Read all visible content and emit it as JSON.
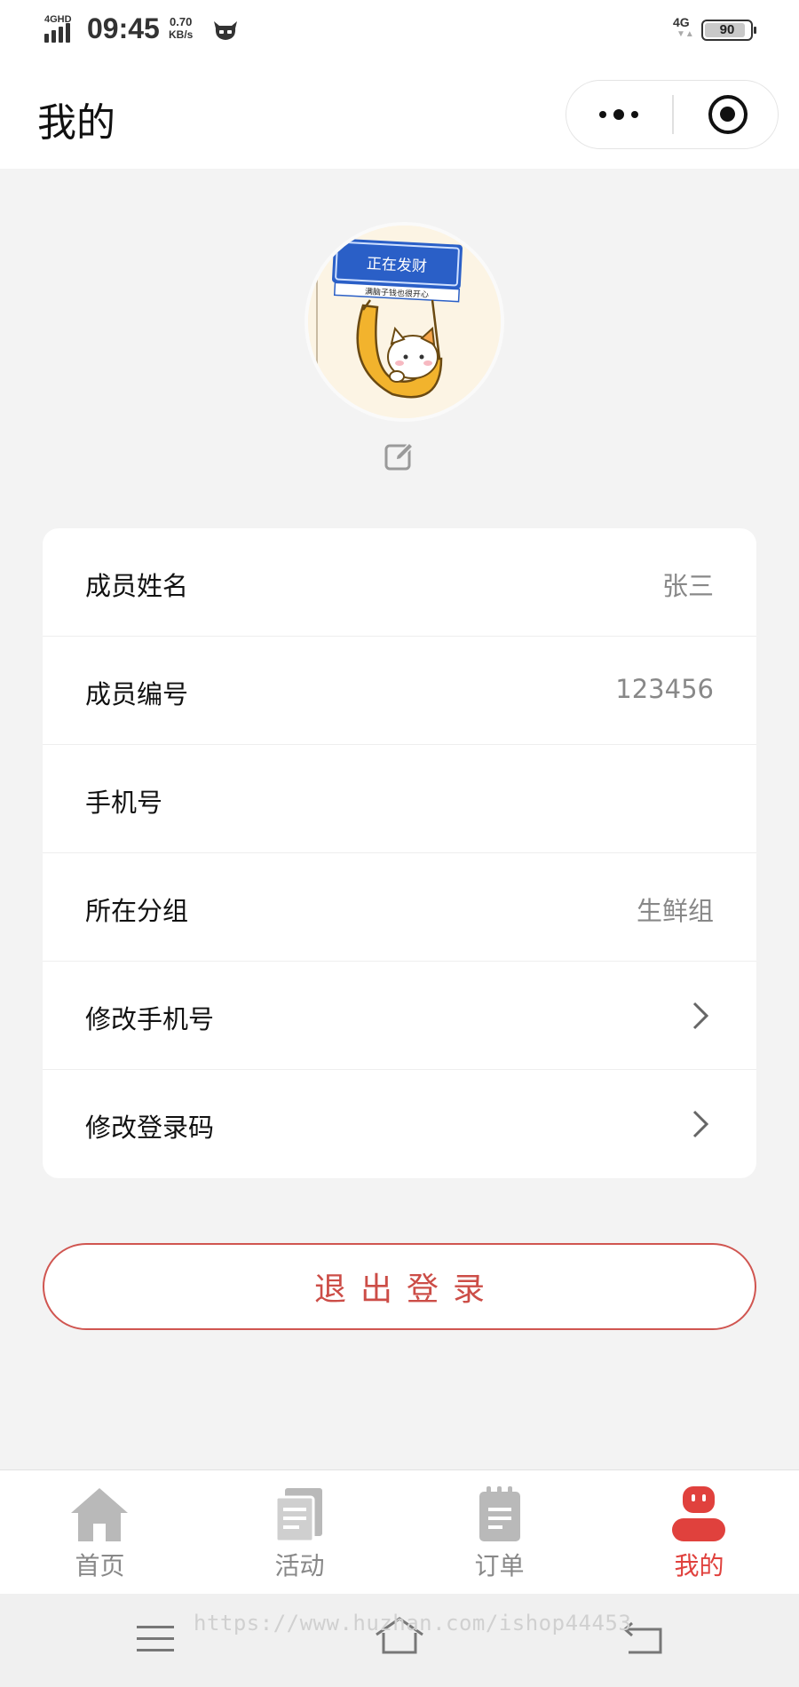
{
  "status_bar": {
    "network": "4GHD",
    "time": "09:45",
    "speed_value": "0.70",
    "speed_unit": "KB/s",
    "network_right": "4G",
    "battery": "90"
  },
  "nav": {
    "title": "我的",
    "more_icon": "more-dots-icon",
    "close_icon": "target-icon"
  },
  "profile": {
    "avatar_sign_text": "正在发财",
    "avatar_sign_subtext": "满脑子钱也很开心",
    "edit_icon": "edit-icon"
  },
  "info_rows": [
    {
      "label": "成员姓名",
      "value": "张三"
    },
    {
      "label": "成员编号",
      "value": "123456"
    },
    {
      "label": "手机号",
      "value": ""
    },
    {
      "label": "所在分组",
      "value": "生鲜组"
    },
    {
      "label": "修改手机号",
      "icon": "chevron-right-icon"
    },
    {
      "label": "修改登录码",
      "icon": "chevron-right-icon"
    }
  ],
  "logout_label": "退出登录",
  "tabs": [
    {
      "label": "首页",
      "icon": "home-icon"
    },
    {
      "label": "活动",
      "icon": "document-icon"
    },
    {
      "label": "订单",
      "icon": "clipboard-icon"
    },
    {
      "label": "我的",
      "icon": "robot-face-icon",
      "active": true
    }
  ],
  "colors": {
    "accent": "#e0413d",
    "logout_text": "#cc4d47",
    "inactive_tab": "#b9b9b9",
    "background": "#f3f3f3"
  },
  "watermark": "https://www.huzhan.com/ishop44453"
}
